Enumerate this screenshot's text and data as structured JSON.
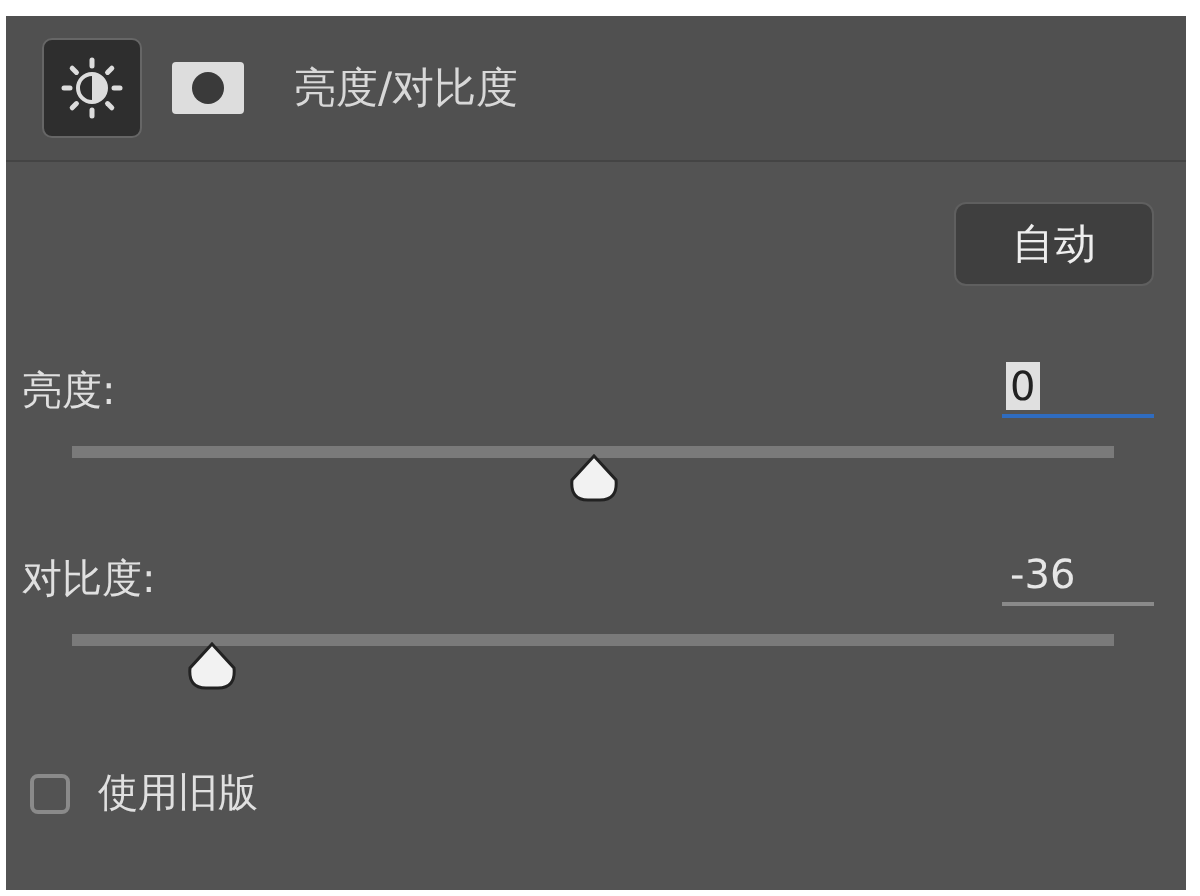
{
  "header": {
    "title": "亮度/对比度",
    "tabs": [
      {
        "kind": "adjustment",
        "selected": true
      },
      {
        "kind": "mask",
        "selected": false
      }
    ]
  },
  "auto_button": "自动",
  "sliders": [
    {
      "label": "亮度:",
      "value": "0",
      "focused": true,
      "level": 0.5
    },
    {
      "label": "对比度:",
      "value": "-36",
      "focused": false,
      "level": 0.134
    }
  ],
  "legacy": {
    "label": "使用旧版",
    "checked": false
  }
}
